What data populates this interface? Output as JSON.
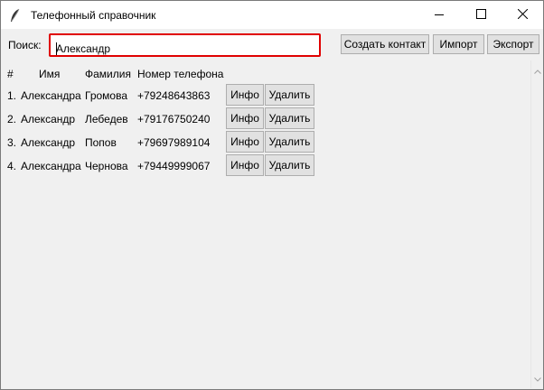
{
  "window": {
    "title": "Телефонный справочник",
    "icons": {
      "app": "feather-icon",
      "minimize": "minimize-icon",
      "maximize": "maximize-icon",
      "close": "close-icon"
    }
  },
  "toolbar": {
    "search_label": "Поиск:",
    "search_value": "Александр",
    "create_label": "Создать контакт",
    "import_label": "Импорт",
    "export_label": "Экспорт",
    "highlight_color": "#e00000"
  },
  "table": {
    "headers": [
      "#",
      "Имя",
      "Фамилия",
      "Номер телефона"
    ],
    "rows": [
      {
        "num": "1.",
        "name": "Александра",
        "surname": "Громова",
        "phone": "+79248643863",
        "info": "Инфо",
        "delete": "Удалить"
      },
      {
        "num": "2.",
        "name": "Александр",
        "surname": "Лебедев",
        "phone": "+79176750240",
        "info": "Инфо",
        "delete": "Удалить"
      },
      {
        "num": "3.",
        "name": "Александр",
        "surname": "Попов",
        "phone": "+79697989104",
        "info": "Инфо",
        "delete": "Удалить"
      },
      {
        "num": "4.",
        "name": "Александра",
        "surname": "Чернова",
        "phone": "+79449999067",
        "info": "Инфо",
        "delete": "Удалить"
      }
    ]
  }
}
